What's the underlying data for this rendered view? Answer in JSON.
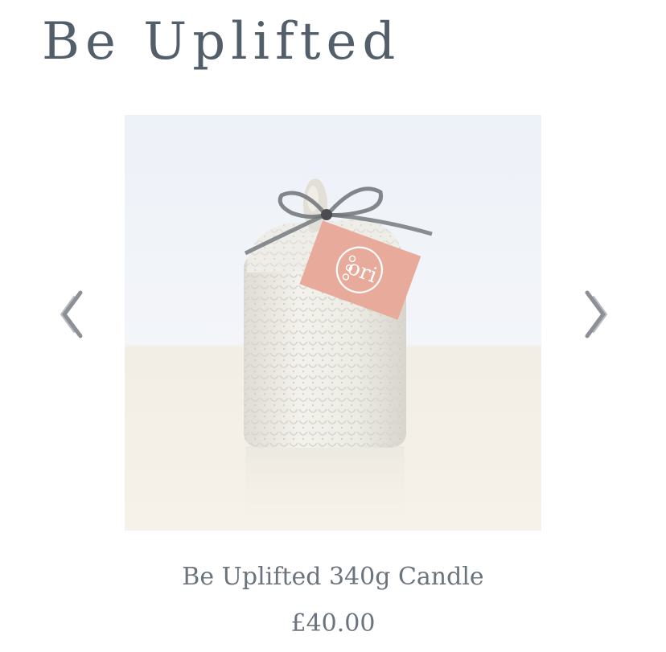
{
  "collection": {
    "title": "Be Uplifted"
  },
  "carousel": {
    "prev_icon": "chevron-left-icon",
    "next_icon": "chevron-right-icon"
  },
  "product": {
    "name": "Be Uplifted 340g Candle",
    "price": "£40.00",
    "tag_brand": "ori",
    "colors": {
      "tag": "#e8ab9b",
      "ribbon": "#6e7378",
      "candle": "#eceae3"
    }
  },
  "colors": {
    "title": "#525e69",
    "text": "#6b747c",
    "arrow": "#8a9096"
  }
}
